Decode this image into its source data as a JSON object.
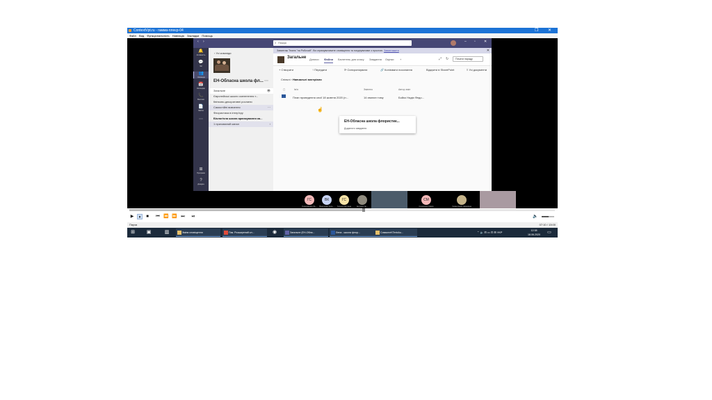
{
  "player": {
    "title": "СоntextVpt.ru - гамма-плеєр-04",
    "menu": [
      "Файл",
      "Вид",
      "Функціональність",
      "Навігація",
      "Закладки",
      "Помощь"
    ],
    "status_left": "Пауза",
    "time": "07:10 / 13:00",
    "progress": 0.55,
    "volume": 0.55
  },
  "teams": {
    "search_placeholder": "Пошук",
    "rail": [
      {
        "icon": "bell-icon",
        "glyph": "🔔",
        "label": "Активність"
      },
      {
        "icon": "chat-icon",
        "glyph": "💬",
        "label": "Чат"
      },
      {
        "icon": "teams-icon",
        "glyph": "👥",
        "label": "Команди"
      },
      {
        "icon": "calendar-icon",
        "glyph": "📅",
        "label": "Календар"
      },
      {
        "icon": "phone-icon",
        "glyph": "📞",
        "label": "Виклики"
      },
      {
        "icon": "files-icon",
        "glyph": "📄",
        "label": "Файли"
      },
      {
        "icon": "more-icon",
        "glyph": "⋯",
        "label": ""
      },
      {
        "icon": "apps-icon",
        "glyph": "⊞",
        "label": "Програми"
      },
      {
        "icon": "help-icon",
        "glyph": "?",
        "label": "Довідка"
      }
    ],
    "back_label": "Усі команди",
    "team_name": "ЕН-Обласна школа фл...",
    "channels": [
      {
        "label": "Загальне",
        "state": "sel",
        "right": "👁"
      },
      {
        "label": "Європейські школи озеленення т...",
        "state": "",
        "right": ""
      },
      {
        "label": "Квітково-декоративні рослини",
        "state": "",
        "right": ""
      },
      {
        "label": "Самостійні вивчення",
        "state": "hov",
        "right": "⋯"
      },
      {
        "label": "Флористика в інтер'єру",
        "state": "",
        "right": ""
      },
      {
        "label": "Біологічна школа аранжування ка...",
        "state": "bold",
        "right": ""
      },
      {
        "label": "1 прихований канал",
        "state": "",
        "right": "›"
      }
    ],
    "banner_text": "Завантаж Teams \"на Робочий\". Ви отримуватимете сповіщення та поєднуватиме з простою.",
    "banner_link": "Завантажити",
    "channel_title": "Загальне",
    "tabs": [
      "Дописи",
      "Файли",
      "Бюлетень для класу",
      "Завдання",
      "Оцінки"
    ],
    "active_tab": 1,
    "meet_label": "Почати нараду",
    "toolbar": [
      "+ Створити",
      "↑ Передати",
      "⟳ Синхронізувати",
      "🔗 Копіювати посилання",
      "Відкрити в SharePoint",
      "≡ Усі документи"
    ],
    "breadcrumb_root": "Спільні",
    "breadcrumb_current": "Навчальні матеріали",
    "columns": [
      "Ім'я",
      "Змінено",
      "Автор змін"
    ],
    "file": {
      "name": "План проведення сесії 18 жовтня 2020 (н...",
      "modified": "14 хвилин тому",
      "author": "Бойко Надія Федо..."
    },
    "tooltip_title": "ЕН-Обласна школа флористик...",
    "tooltip_sub": "Доданого завдання"
  },
  "participants": [
    {
      "initials": "ГС",
      "name": "Герасименко Ле...",
      "color": "#f4b8b8"
    },
    {
      "initials": "ВК",
      "name": "Вакуленко Кате...",
      "color": "#c8d4f4"
    },
    {
      "initials": "ГС",
      "name": "Гельда Світлана",
      "color": "#f6e2a6"
    },
    {
      "initials": "",
      "name": "Антонюк Ар...",
      "color": "#8f8a7d"
    },
    {
      "initials": "СМ",
      "name": "Сидоренко Марія",
      "color": "#f4b8b8"
    },
    {
      "initials": "",
      "name": "Чумак Надія Назарівна",
      "color": "#c6b48a"
    }
  ],
  "taskbar": {
    "apps": [
      {
        "label": "Зміни сповіщення",
        "color": "#e8c06a"
      },
      {
        "label": "Пак. Розширений кл...",
        "color": "#e04c3b"
      },
      {
        "label": "Загальне (ЕН-Обла...",
        "color": "#6264a7"
      },
      {
        "label": "Лена - школа флор...",
        "color": "#2b579a"
      },
      {
        "label": "СoвасmеKTenbAu...",
        "color": "#e8c06a"
      }
    ],
    "tray": "⌃ 🔈 ⊟ ▭ ⊡ ⊞ УКР",
    "clock_time": "12:38",
    "clock_date": "18.06.2020"
  }
}
